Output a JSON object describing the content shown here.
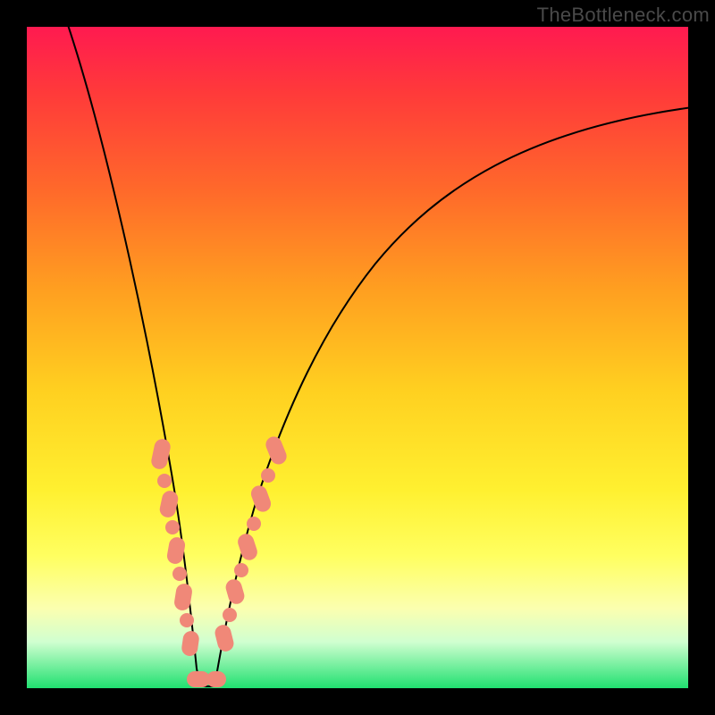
{
  "watermark": "TheBottleneck.com",
  "colors": {
    "dot": "#f08878",
    "curve": "#000000",
    "gradient_top": "#ff1a50",
    "gradient_mid": "#ffd020",
    "gradient_bottom": "#20e070"
  },
  "chart_data": {
    "type": "line",
    "title": "",
    "xlabel": "",
    "ylabel": "",
    "xlim": [
      0,
      100
    ],
    "ylim": [
      0,
      100
    ],
    "grid": false,
    "legend": false,
    "note": "V-shaped bottleneck curve over rainbow gradient. Minimum (green zone) near x≈26. Salmon markers cluster on both arms near the valley.",
    "series": [
      {
        "name": "curve",
        "x": [
          5,
          10,
          14,
          18,
          20,
          22,
          24,
          25,
          26,
          27,
          28,
          30,
          32,
          36,
          42,
          50,
          60,
          72,
          86,
          100
        ],
        "y": [
          100,
          80,
          60,
          40,
          30,
          20,
          10,
          5,
          0,
          3,
          8,
          16,
          24,
          36,
          50,
          62,
          72,
          80,
          85,
          88
        ]
      }
    ],
    "markers": {
      "name": "highlighted points",
      "color": "#f08878",
      "shape": "round/pill",
      "x": [
        19.0,
        19.6,
        20.5,
        21.0,
        21.6,
        22.4,
        23.0,
        23.6,
        24.2,
        25.3,
        27.0,
        28.4,
        29.0,
        29.8,
        30.5,
        31.4,
        32.2,
        33.0,
        33.8,
        34.6
      ],
      "y": [
        35.0,
        32.0,
        27.0,
        24.0,
        21.0,
        17.0,
        14.0,
        11.0,
        8.0,
        2.0,
        2.0,
        9.0,
        12.0,
        16.0,
        19.0,
        23.0,
        26.0,
        29.0,
        32.0,
        35.0
      ]
    }
  }
}
